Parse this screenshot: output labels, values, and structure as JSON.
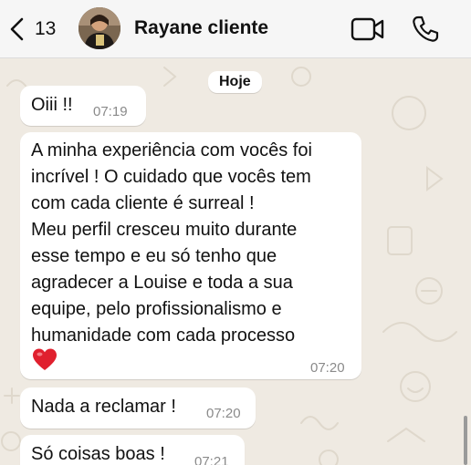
{
  "header": {
    "back_count": "13",
    "contact_name": "Rayane cliente",
    "icons": [
      "chevron-left-icon",
      "video-call-icon",
      "phone-icon"
    ]
  },
  "chat": {
    "date_label": "Hoje",
    "messages": [
      {
        "text": "Oiii !!",
        "time": "07:19"
      },
      {
        "text": "A minha experiência com vocês foi\nincrível ! O cuidado que vocês tem\ncom cada cliente é surreal !\nMeu perfil cresceu muito durante\nesse tempo e eu só tenho que\nagradecer a Louise e toda a sua\nequipe, pelo profissionalismo e\nhumanidade com cada processo",
        "emoji": "red-heart-icon",
        "time": "07:20"
      },
      {
        "text": "Nada a reclamar !",
        "time": "07:20"
      },
      {
        "text": "Só coisas boas !",
        "time": "07:21"
      }
    ]
  },
  "colors": {
    "wallpaper": "#efeae2",
    "bubble": "#ffffff",
    "header": "#f6f6f6",
    "heart": "#e0202e"
  }
}
